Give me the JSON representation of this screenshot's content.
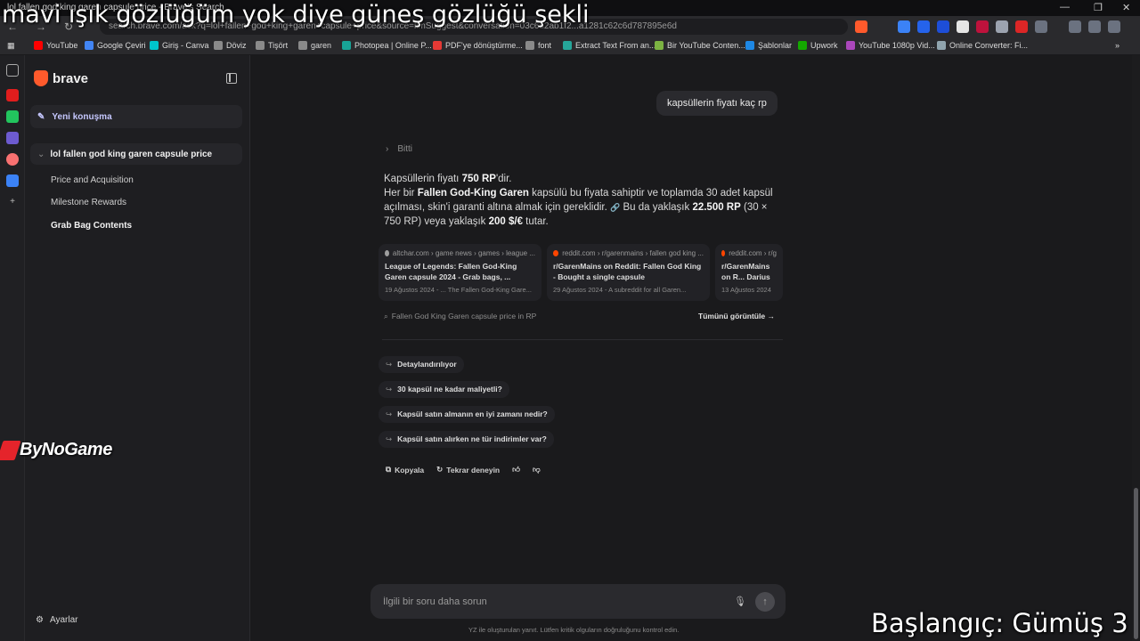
{
  "browser": {
    "tab_title": "lol fallen god king garen capsule price - Brave's Search",
    "url": "search.brave.com/ask?q=lol+fallen+god+king+garen+capsule+price&source=llmSuggest&conversation=03c6d2ab1f2...a1281c62c6d787895e6d",
    "window_controls": {
      "minimize": "—",
      "restore": "❐",
      "close": "✕"
    },
    "nav": {
      "back": "←",
      "forward": "→",
      "reload": "↻"
    },
    "bookmarks": [
      {
        "label": "YouTube",
        "color": "#ff0000"
      },
      {
        "label": "Google Çeviri",
        "color": "#4285f4"
      },
      {
        "label": "Giriş - Canva",
        "color": "#00c4cc"
      },
      {
        "label": "Döviz",
        "color": "#8a8a8a"
      },
      {
        "label": "Tişört",
        "color": "#8a8a8a"
      },
      {
        "label": "garen",
        "color": "#8a8a8a"
      },
      {
        "label": "Photopea | Online P...",
        "color": "#18a497"
      },
      {
        "label": "PDF'ye dönüştürme...",
        "color": "#e53935"
      },
      {
        "label": "font",
        "color": "#8a8a8a"
      },
      {
        "label": "Extract Text From an...",
        "color": "#26a69a"
      },
      {
        "label": "Bir YouTube Conten...",
        "color": "#7cb342"
      },
      {
        "label": "Şablonlar",
        "color": "#1e88e5"
      },
      {
        "label": "Upwork",
        "color": "#14a800"
      },
      {
        "label": "YouTube 1080p Vid...",
        "color": "#ab47bc"
      },
      {
        "label": "Online Converter: Fi...",
        "color": "#90a4ae"
      }
    ]
  },
  "sidebar": {
    "brand": "brave",
    "new_chat_label": "Yeni konuşma",
    "conversation_title": "lol fallen god king garen capsule price",
    "sub_items": [
      {
        "label": "Price and Acquisition"
      },
      {
        "label": "Milestone Rewards"
      },
      {
        "label": "Grab Bag Contents"
      }
    ],
    "settings_label": "Ayarlar"
  },
  "chat": {
    "user_message": "kapsüllerin fiyatı kaç rp",
    "status_label": "Bitti",
    "answer": {
      "p1_pre": "Kapsüllerin fiyatı ",
      "p1_bold": "750 RP",
      "p1_post": "'dir.",
      "p2_pre": "Her bir ",
      "p2_bold": "Fallen God-King Garen",
      "p2_mid": " kapsülü bu fiyata sahiptir ve toplamda 30 adet kapsül açılması, skin'i garanti altına almak için gereklidir.",
      "p2_after_icon": " Bu da yaklaşık ",
      "p2_bold2": "22.500 RP",
      "p2_mid2": " (30 × 750 RP) veya yaklaşık ",
      "p2_bold3": "200 $/€",
      "p2_end": " tutar."
    },
    "sources": [
      {
        "domain": "altchar.com › game news › games › league ...",
        "title": "League of Legends: Fallen God-King Garen capsule 2024 - Grab bags, ...",
        "date": "19 Ağustos 2024",
        "snippet": "... The Fallen God-King Gare...",
        "fav_color": "#9e9e9e"
      },
      {
        "domain": "reddit.com › r/garenmains › fallen god king ...",
        "title": "r/GarenMains on Reddit: Fallen God King - Bought a single capsule",
        "date": "29 Ağustos 2024",
        "snippet": "A subreddit for all Garen...",
        "fav_color": "#ff4500"
      },
      {
        "domain": "reddit.com › r/g",
        "title": "r/GarenMains on R... Darius and Fallen",
        "date": "13 Ağustos 2024",
        "snippet": "",
        "fav_color": "#ff4500"
      }
    ],
    "search_query": "Fallen God King Garen capsule price in RP",
    "see_all_label": "Tümünü görüntüle",
    "followups": [
      {
        "label": "Detaylandırılıyor"
      },
      {
        "label": "30 kapsül ne kadar maliyetli?"
      },
      {
        "label": "Kapsül satın almanın en iyi zamanı nedir?"
      },
      {
        "label": "Kapsül satın alırken ne tür indirimler var?"
      }
    ],
    "actions": {
      "copy_label": "Kopyala",
      "retry_label": "Tekrar deneyin"
    },
    "input_placeholder": "İlgili bir soru daha sorun",
    "disclaimer": "YZ ile oluşturulan yanıt. Lütfen kritik olguların doğruluğunu kontrol edin."
  },
  "overlays": {
    "top_caption": "mavi ışık gözlüğüm yok diye güneş gözlüğü şekli",
    "bottom_caption": "Başlangıç: Gümüş 3",
    "watermark": "ByNoGame"
  },
  "colors": {
    "accent_newchat": "#c6c8ff",
    "brave_orange": "#ff5a2c"
  }
}
